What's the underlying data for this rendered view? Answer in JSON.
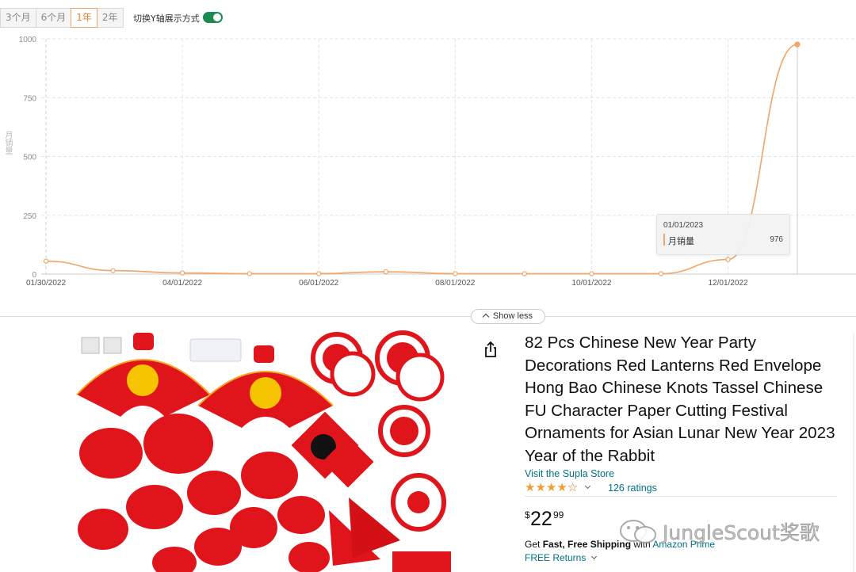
{
  "toolbar": {
    "range_tabs": [
      {
        "label": "3个月",
        "active": false
      },
      {
        "label": "6个月",
        "active": false
      },
      {
        "label": "1年",
        "active": true
      },
      {
        "label": "2年",
        "active": false
      }
    ],
    "toggle_label": "切换Y轴展示方式",
    "toggle_on": true
  },
  "chart_data": {
    "type": "line",
    "title": "",
    "xlabel": "",
    "ylabel": "月销量",
    "ylim": [
      0,
      1000
    ],
    "yticks": [
      "0",
      "250",
      "500",
      "750",
      "1000"
    ],
    "xtick_labels": [
      "01/30/2022",
      "04/01/2022",
      "06/01/2022",
      "08/01/2022",
      "10/01/2022",
      "12/01/2022"
    ],
    "x": [
      "01/30/2022",
      "03/01/2022",
      "04/01/2022",
      "05/01/2022",
      "06/01/2022",
      "07/01/2022",
      "08/01/2022",
      "09/01/2022",
      "10/01/2022",
      "11/01/2022",
      "12/01/2022",
      "01/01/2023"
    ],
    "series": [
      {
        "name": "月销量",
        "color": "#f0a468",
        "values": [
          55,
          15,
          5,
          2,
          2,
          10,
          2,
          2,
          2,
          2,
          62,
          976
        ]
      }
    ],
    "grid": true,
    "tooltip": {
      "date": "01/01/2023",
      "label": "月销量",
      "value": "976"
    }
  },
  "show_less_label": "Show less",
  "product": {
    "title": "82 Pcs Chinese New Year Party Decorations Red Lanterns Red Envelope Hong Bao Chinese Knots Tassel Chinese FU Character Paper Cutting Festival Ornaments for Asian Lunar New Year 2023 Year of the Rabbit",
    "store_link": "Visit the Supla Store",
    "rating": 4.0,
    "ratings_count": "126 ratings",
    "price_currency": "$",
    "price_whole": "22",
    "price_fraction": "99",
    "shipping_prefix": "Get ",
    "shipping_bold": "Fast, Free Shipping",
    "shipping_with": " with ",
    "shipping_prime": "Amazon Prime",
    "returns": "FREE Returns"
  },
  "watermark": "JungleScout奖歌",
  "colors": {
    "line": "#f0a468",
    "link": "#007185",
    "toggle": "#1a8a4e",
    "star": "#f19e38",
    "decor_red": "#e0151b"
  }
}
